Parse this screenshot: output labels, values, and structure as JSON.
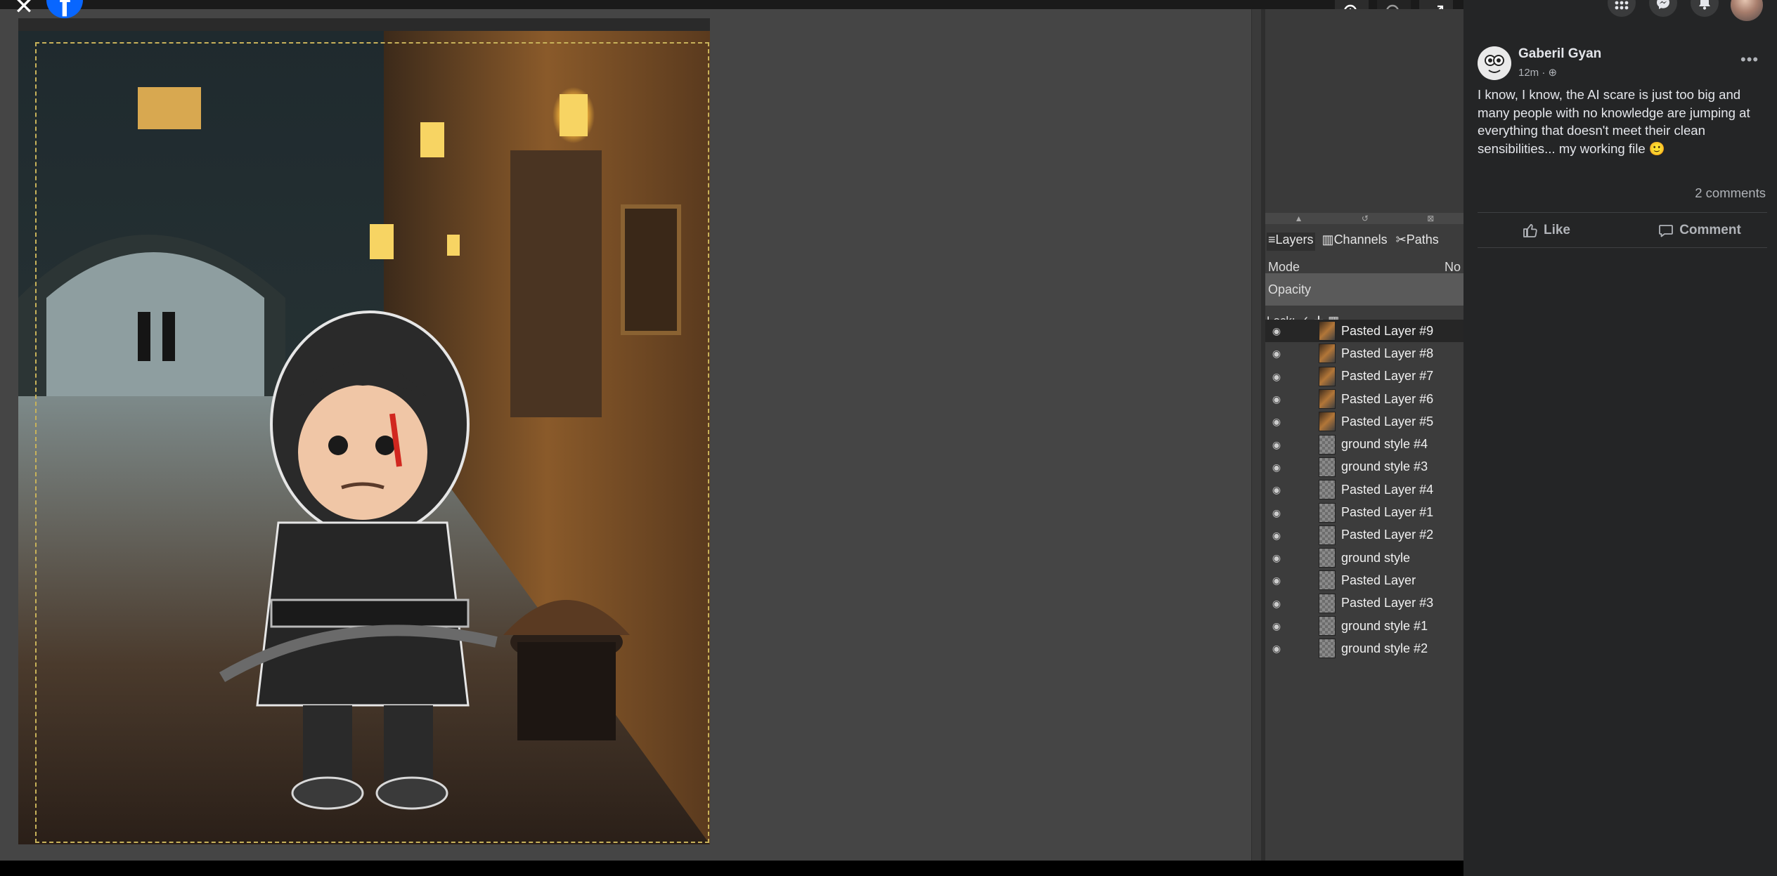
{
  "viewer": {
    "close_glyph": "✕",
    "logo_letter": "f",
    "controls": [
      "zoom-in-icon",
      "zoom-out-icon",
      "fullscreen-icon"
    ]
  },
  "gimp": {
    "tabs": [
      "Layers",
      "Channels",
      "Paths"
    ],
    "mode_label": "Mode",
    "mode_value": "No",
    "opacity_label": "Opacity",
    "lock_label": "Lock:",
    "layers": [
      {
        "name": "Pasted Layer #9",
        "thumb": "image",
        "selected": true
      },
      {
        "name": "Pasted Layer #8",
        "thumb": "image",
        "selected": false
      },
      {
        "name": "Pasted Layer #7",
        "thumb": "image",
        "selected": false
      },
      {
        "name": "Pasted Layer #6",
        "thumb": "image",
        "selected": false
      },
      {
        "name": "Pasted Layer #5",
        "thumb": "image",
        "selected": false
      },
      {
        "name": "ground style #4",
        "thumb": "checker",
        "selected": false
      },
      {
        "name": "ground style #3",
        "thumb": "checker",
        "selected": false
      },
      {
        "name": "Pasted Layer #4",
        "thumb": "checker",
        "selected": false
      },
      {
        "name": "Pasted Layer #1",
        "thumb": "checker",
        "selected": false
      },
      {
        "name": "Pasted Layer #2",
        "thumb": "checker",
        "selected": false
      },
      {
        "name": "ground style",
        "thumb": "checker",
        "selected": false
      },
      {
        "name": "Pasted Layer",
        "thumb": "checker",
        "selected": false
      },
      {
        "name": "Pasted Layer #3",
        "thumb": "checker",
        "selected": false
      },
      {
        "name": "ground style #1",
        "thumb": "checker",
        "selected": false
      },
      {
        "name": "ground style #2",
        "thumb": "checker",
        "selected": false
      }
    ]
  },
  "post": {
    "author": "Gaberil Gyan",
    "time": "12m",
    "text": "I know, I know, the AI scare is just too big and many people with no knowledge are jumping at everything that doesn't meet their clean sensibilities... my working file 🙂",
    "comments_count": "2 comments",
    "like_label": "Like",
    "comment_label": "Comment",
    "more_label": "•••"
  },
  "colors": {
    "fb_bg": "#242526",
    "fb_blue": "#0866ff",
    "gimp_canvas_bg": "#454545"
  }
}
